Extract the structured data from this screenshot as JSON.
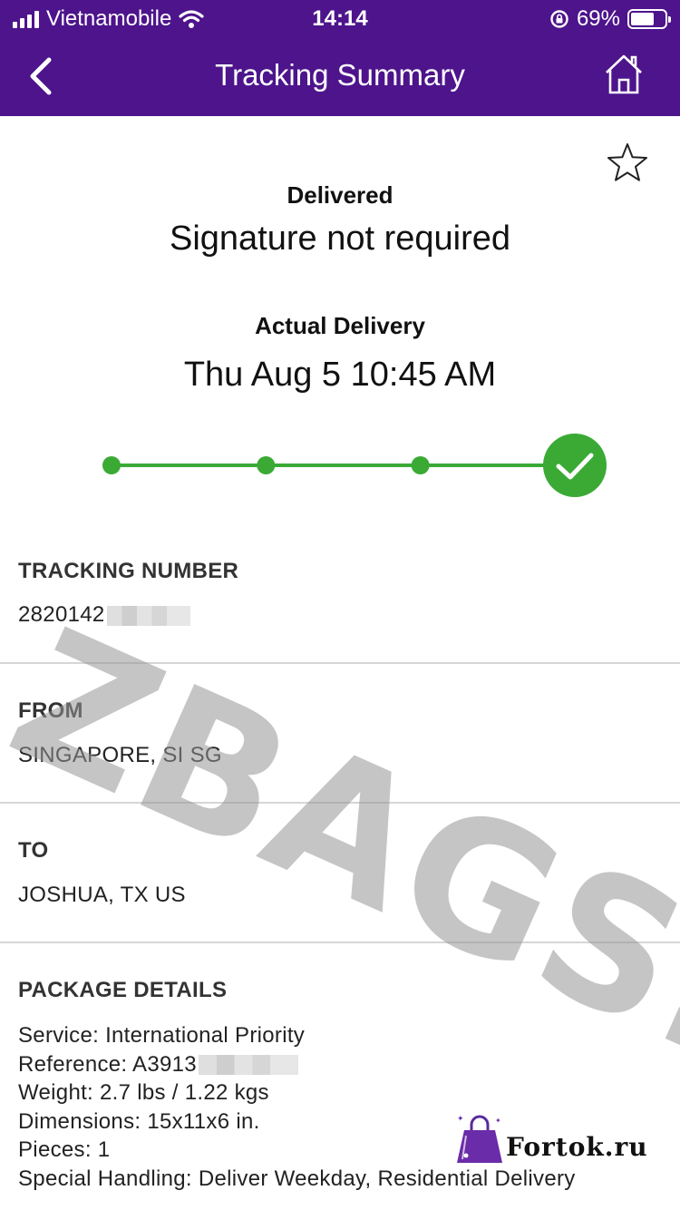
{
  "status_bar": {
    "carrier": "Vietnamobile",
    "time": "14:14",
    "battery": "69%",
    "battery_level": 0.69
  },
  "nav": {
    "title": "Tracking Summary"
  },
  "shipment": {
    "status": "Delivered",
    "status_detail": "Signature not required",
    "delivery_label": "Actual Delivery",
    "delivery_date": "Thu Aug 5 10:45 AM",
    "progress_steps": 4,
    "progress_completed": 4
  },
  "tracking": {
    "heading": "TRACKING NUMBER",
    "value": "2820142"
  },
  "from": {
    "heading": "FROM",
    "value": "SINGAPORE, SI SG"
  },
  "to": {
    "heading": "TO",
    "value": "JOSHUA, TX US"
  },
  "package": {
    "heading": "PACKAGE DETAILS",
    "service": "Service: International Priority",
    "reference": "Reference: A3913",
    "weight": "Weight: 2.7 lbs / 1.22 kgs",
    "dimensions": "Dimensions: 15x11x6 in.",
    "pieces": "Pieces: 1",
    "special_handling": "Special Handling: Deliver Weekday, Residential Delivery"
  },
  "overlays": {
    "watermark": "ZBAGS.SU",
    "logo_text": "Fortok.ru"
  },
  "colors": {
    "brand_purple": "#4d148c",
    "progress_green": "#3aaa35"
  }
}
